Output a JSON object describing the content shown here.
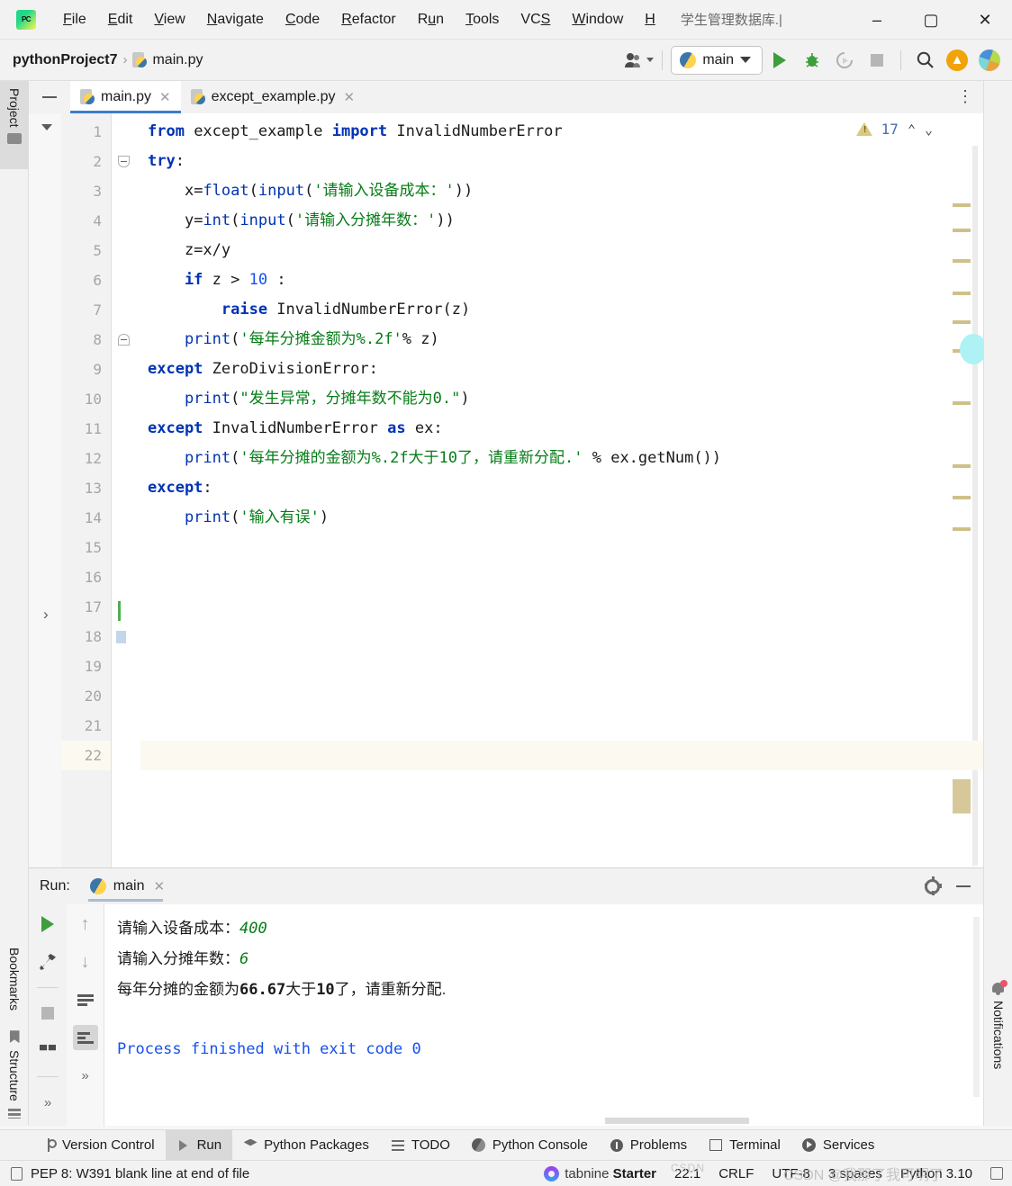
{
  "titlebar": {
    "logo": "pycharm-logo",
    "menus": [
      "File",
      "Edit",
      "View",
      "Navigate",
      "Code",
      "Refactor",
      "Run",
      "Tools",
      "VCS",
      "Window",
      "H"
    ],
    "window_title": "学生管理数据库.|",
    "minimize": "–",
    "maximize": "▢",
    "close": "✕"
  },
  "navbar": {
    "project": "pythonProject7",
    "separator": "›",
    "file": "main.py",
    "run_config": "main",
    "icons": [
      "user-avatar-icon",
      "run-icon",
      "debug-icon",
      "coverage-icon",
      "stop-icon",
      "search-everywhere-icon",
      "update-icon",
      "multi-color-icon"
    ]
  },
  "left_strip": {
    "project_tab": "Project",
    "bookmarks_tab": "Bookmarks",
    "structure_tab": "Structure"
  },
  "right_strip": {
    "notifications_tab": "Notifications"
  },
  "editor_tabs": [
    {
      "label": "main.py",
      "active": true,
      "close": "✕"
    },
    {
      "label": "except_example.py",
      "active": false,
      "close": "✕"
    }
  ],
  "editor": {
    "warning_count": "17",
    "warning_icon": "warning-triangle-icon",
    "prev_chevron": "⌃",
    "next_chevron": "⌄",
    "more_menu": "⋮",
    "highlighted_line": 22,
    "total_lines": 22,
    "lines": [
      {
        "n": 1,
        "tokens": [
          {
            "t": "from ",
            "c": "kw"
          },
          {
            "t": "except_example ",
            "c": "pl"
          },
          {
            "t": "import ",
            "c": "kw"
          },
          {
            "t": "InvalidNumberError",
            "c": "pl"
          }
        ]
      },
      {
        "n": 2,
        "tokens": [
          {
            "t": "try",
            "c": "kw"
          },
          {
            "t": ":",
            "c": "pl"
          }
        ],
        "fold": "minus-tri"
      },
      {
        "n": 3,
        "tokens": [
          {
            "t": "    x",
            "c": "pl"
          },
          {
            "t": "=",
            "c": "pl"
          },
          {
            "t": "float",
            "c": "bf"
          },
          {
            "t": "(",
            "c": "pl"
          },
          {
            "t": "input",
            "c": "bf"
          },
          {
            "t": "(",
            "c": "pl"
          },
          {
            "t": "'请输入设备成本：'",
            "c": "str"
          },
          {
            "t": "))",
            "c": "pl"
          }
        ]
      },
      {
        "n": 4,
        "tokens": [
          {
            "t": "    y",
            "c": "pl"
          },
          {
            "t": "=",
            "c": "pl"
          },
          {
            "t": "int",
            "c": "bf"
          },
          {
            "t": "(",
            "c": "pl"
          },
          {
            "t": "input",
            "c": "bf"
          },
          {
            "t": "(",
            "c": "pl"
          },
          {
            "t": "'请输入分摊年数：'",
            "c": "str"
          },
          {
            "t": "))",
            "c": "pl"
          }
        ]
      },
      {
        "n": 5,
        "tokens": [
          {
            "t": "    z=x/y",
            "c": "pl"
          }
        ]
      },
      {
        "n": 6,
        "tokens": [
          {
            "t": "    if",
            "c": "kw"
          },
          {
            "t": " z > ",
            "c": "pl"
          },
          {
            "t": "10",
            "c": "num"
          },
          {
            "t": " :",
            "c": "pl"
          }
        ]
      },
      {
        "n": 7,
        "tokens": [
          {
            "t": "        raise",
            "c": "kw"
          },
          {
            "t": " InvalidNumberError(z)",
            "c": "pl"
          }
        ]
      },
      {
        "n": 8,
        "tokens": [
          {
            "t": "    print",
            "c": "bf"
          },
          {
            "t": "(",
            "c": "pl"
          },
          {
            "t": "'每年分摊金额为%.2f'",
            "c": "str"
          },
          {
            "t": "% z)",
            "c": "pl"
          }
        ],
        "fold": "minus-end"
      },
      {
        "n": 9,
        "tokens": [
          {
            "t": "except",
            "c": "kw"
          },
          {
            "t": " ZeroDivisionError:",
            "c": "pl"
          }
        ]
      },
      {
        "n": 10,
        "tokens": [
          {
            "t": "    print",
            "c": "bf"
          },
          {
            "t": "(",
            "c": "pl"
          },
          {
            "t": "\"发生异常，分摊年数不能为0.\"",
            "c": "str"
          },
          {
            "t": ")",
            "c": "pl"
          }
        ]
      },
      {
        "n": 11,
        "tokens": [
          {
            "t": "except",
            "c": "kw"
          },
          {
            "t": " InvalidNumberError ",
            "c": "pl"
          },
          {
            "t": "as",
            "c": "kw"
          },
          {
            "t": " ex:",
            "c": "pl"
          }
        ]
      },
      {
        "n": 12,
        "tokens": [
          {
            "t": "    print",
            "c": "bf"
          },
          {
            "t": "(",
            "c": "pl"
          },
          {
            "t": "'每年分摊的金额为%.2f大于10了，请重新分配.'",
            "c": "str"
          },
          {
            "t": " % ex.getNum())",
            "c": "pl"
          }
        ]
      },
      {
        "n": 13,
        "tokens": [
          {
            "t": "except",
            "c": "kw"
          },
          {
            "t": ":",
            "c": "pl"
          }
        ]
      },
      {
        "n": 14,
        "tokens": [
          {
            "t": "    print",
            "c": "bf"
          },
          {
            "t": "(",
            "c": "pl"
          },
          {
            "t": "'输入有误'",
            "c": "str"
          },
          {
            "t": ")",
            "c": "pl"
          }
        ]
      },
      {
        "n": 15,
        "tokens": []
      },
      {
        "n": 16,
        "tokens": []
      },
      {
        "n": 17,
        "tokens": []
      },
      {
        "n": 18,
        "tokens": []
      },
      {
        "n": 19,
        "tokens": []
      },
      {
        "n": 20,
        "tokens": []
      },
      {
        "n": 21,
        "tokens": []
      },
      {
        "n": 22,
        "tokens": []
      }
    ]
  },
  "run_panel": {
    "title": "Run:",
    "tab_label": "main",
    "tab_close": "✕",
    "settings_icon": "gear-icon",
    "minimize_icon": "minimize-icon",
    "toolbar_left": [
      "rerun-icon",
      "wrench-icon",
      "stop-icon",
      "layout-icon",
      "expand-icon"
    ],
    "toolbar_right": [
      "up-arrow-icon",
      "down-arrow-icon",
      "soft-wrap-icon",
      "scroll-to-end-icon",
      "expand-icon"
    ],
    "console": [
      {
        "text": "请输入设备成本：",
        "value": "400",
        "style": "input"
      },
      {
        "text": "请输入分摊年数：",
        "value": "6",
        "style": "input"
      },
      {
        "text": "每年分摊的金额为66.67大于10了，请重新分配.",
        "value": "",
        "style": "output"
      },
      {
        "text": "",
        "value": "",
        "style": "blank"
      },
      {
        "text": "Process finished with exit code 0",
        "value": "",
        "style": "exit"
      }
    ]
  },
  "bottom_tabs": [
    {
      "label": "Version Control",
      "icon": "branch-icon",
      "active": false
    },
    {
      "label": "Run",
      "icon": "run-triangle-icon",
      "active": true
    },
    {
      "label": "Python Packages",
      "icon": "stack-icon",
      "active": false
    },
    {
      "label": "TODO",
      "icon": "list-icon",
      "active": false
    },
    {
      "label": "Python Console",
      "icon": "python-icon",
      "active": false
    },
    {
      "label": "Problems",
      "icon": "problem-icon",
      "active": false
    },
    {
      "label": "Terminal",
      "icon": "terminal-icon",
      "active": false
    },
    {
      "label": "Services",
      "icon": "services-icon",
      "active": false
    }
  ],
  "statusbar": {
    "message": "PEP 8: W391 blank line at end of file",
    "tabnine_brand": "tabnine",
    "tabnine_plan": "Starter",
    "caret": "22:1",
    "line_sep": "CRLF",
    "encoding": "UTF-8",
    "indent": "3 spaces",
    "interpreter": "Python 3.10",
    "lock_icon": "lock-icon"
  },
  "watermark": {
    "text": "CSDN @我那了我可明了",
    "small": "CSDN"
  },
  "colors": {
    "accent": "#3c7ecb",
    "keyword": "#0033b3",
    "string": "#067d17",
    "number": "#1750eb",
    "warning": "#d9c97e",
    "run_green": "#3c9e3c"
  }
}
